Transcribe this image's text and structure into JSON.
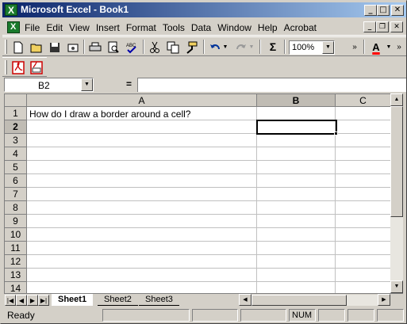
{
  "window": {
    "title": "Microsoft Excel - Book1",
    "minimize": "_",
    "maximize": "□",
    "close": "✕"
  },
  "menubar": {
    "items": [
      "File",
      "Edit",
      "View",
      "Insert",
      "Format",
      "Tools",
      "Data",
      "Window",
      "Help",
      "Acrobat"
    ],
    "doc_minimize": "_",
    "doc_restore": "❐",
    "doc_close": "✕"
  },
  "toolbar": {
    "zoom": "100%",
    "sum": "Σ",
    "font_color_label": "A"
  },
  "formula_bar": {
    "name_box": "B2",
    "equals": "=",
    "formula": ""
  },
  "sheet": {
    "columns": [
      "A",
      "B",
      "C"
    ],
    "active_column": "B",
    "rows": [
      "1",
      "2",
      "3",
      "4",
      "5",
      "6",
      "7",
      "8",
      "9",
      "10",
      "11",
      "12",
      "13",
      "14"
    ],
    "active_row": "2",
    "cells": {
      "A1": "How do I draw a border around a cell?"
    }
  },
  "tabs": {
    "sheets": [
      "Sheet1",
      "Sheet2",
      "Sheet3"
    ],
    "active": "Sheet1"
  },
  "status": {
    "text": "Ready",
    "num": "NUM"
  },
  "colors": {
    "titlebar_start": "#0a246a",
    "titlebar_end": "#a6caf0",
    "chrome": "#d4d0c8",
    "font_color_accent": "#ff0000",
    "pdf_red": "#cc0000"
  }
}
